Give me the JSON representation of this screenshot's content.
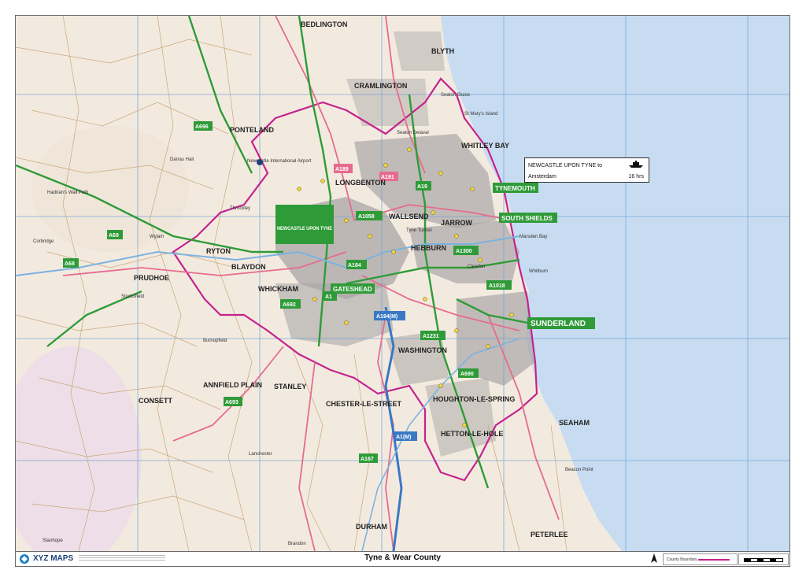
{
  "footer": {
    "brand": "XYZ MAPS",
    "title": "Tyne & Wear County",
    "legend_label": "County Boundary"
  },
  "ferry": {
    "route": "NEWCASTLE UPON TYNE to",
    "destination": "Amsterdam",
    "duration": "16 hrs"
  },
  "colors": {
    "sea": "#c7dcf1",
    "land": "#f3eadf",
    "urban": "#a9a6a6",
    "county_boundary": "#c4238d",
    "primary_road": "#2f9b38",
    "a_road": "#e66b8f",
    "motorway": "#3a78c4",
    "grid": "#6fa3d6",
    "footer_brand": "#1d3f76"
  },
  "places": {
    "newcastle": "NEWCASTLE UPON TYNE",
    "sunderland": "SUNDERLAND",
    "gateshead": "GATESHEAD",
    "tynemouth": "TYNEMOUTH",
    "south_shields": "SOUTH SHIELDS",
    "blyth": "BLYTH",
    "bedlington": "BEDLINGTON",
    "cramlington": "CRAMLINGTON",
    "whitley_bay": "WHITLEY BAY",
    "seaton_delaval": "Seaton Delaval",
    "longbenton": "LONGBENTON",
    "wallsend": "WALLSEND",
    "jarrow": "JARROW",
    "hebburn": "HEBBURN",
    "washington": "WASHINGTON",
    "houghton": "HOUGHTON-LE-SPRING",
    "hetton": "HETTON-LE-HOLE",
    "seaham": "SEAHAM",
    "chester": "CHESTER-LE-STREET",
    "stanley": "STANLEY",
    "annfield": "ANNFIELD PLAIN",
    "consett": "CONSETT",
    "durham": "DURHAM",
    "ponteland": "PONTELAND",
    "prudhoe": "PRUDHOE",
    "whickham": "WHICKHAM",
    "blaydon": "BLAYDON",
    "ryton": "RYTON",
    "corbridge": "Corbridge",
    "stocksfield": "Stocksfield",
    "wylam": "Wylam",
    "throckley": "Throckley",
    "cleadon": "Cleadon",
    "whitburn": "Whitburn",
    "peterlee": "PETERLEE",
    "brandon": "Brandon",
    "lanchester": "Lanchester",
    "stanhope": "Stanhope",
    "burnopfield": "Burnopfield",
    "darras_hall": "Darras Hall",
    "seaton_sluice": "Seaton Sluice",
    "st_marys": "St Mary's Island",
    "newcastle_airport": "Newcastle International Airport",
    "hadrians_wall": "Hadrian's Wall Path",
    "tyne_tunnel": "Tyne Tunnel",
    "beacon_point": "Beacon Point",
    "marsden_bay": "Marsden Bay"
  },
  "roads": {
    "a1": "A1",
    "a19": "A19",
    "a184": "A184",
    "a194m": "A194(M)",
    "a1058": "A1058",
    "a1300": "A1300",
    "a1018": "A1018",
    "a1231": "A1231",
    "a692": "A692",
    "a690": "A690",
    "a69": "A69",
    "a68": "A68",
    "a1m": "A1(M)",
    "a167": "A167",
    "a693": "A693",
    "a191": "A191",
    "a189": "A189",
    "a696": "A696"
  }
}
